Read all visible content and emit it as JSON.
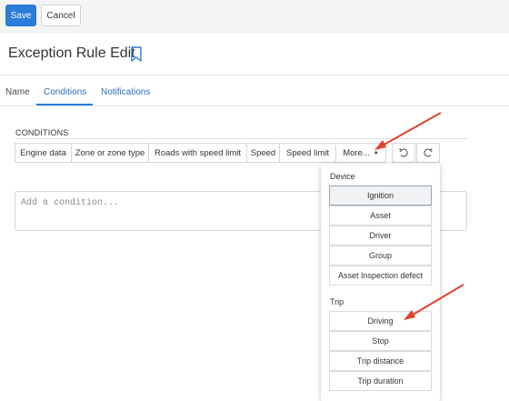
{
  "toolbar": {
    "save_label": "Save",
    "cancel_label": "Cancel"
  },
  "page": {
    "title": "Exception Rule Edit"
  },
  "tabs": [
    {
      "label": "Name"
    },
    {
      "label": "Conditions"
    },
    {
      "label": "Notifications"
    }
  ],
  "conditions": {
    "heading": "CONDITIONS",
    "buttons": [
      {
        "label": "Engine data"
      },
      {
        "label": "Zone or zone type"
      },
      {
        "label": "Roads with speed limit"
      },
      {
        "label": "Speed"
      },
      {
        "label": "Speed limit"
      },
      {
        "label": "More..."
      }
    ],
    "input_placeholder": "Add a condition..."
  },
  "dropdown": {
    "groups": [
      {
        "label": "Device",
        "items": [
          "Ignition",
          "Asset",
          "Driver",
          "Group",
          "Asset Inspection defect"
        ]
      },
      {
        "label": "Trip",
        "items": [
          "Driving",
          "Stop",
          "Trip distance",
          "Trip duration"
        ]
      }
    ],
    "selected": "Ignition"
  },
  "colors": {
    "accent": "#2a7cd8",
    "annotation_arrow": "#e0442b"
  },
  "icons": [
    "bookmark-icon",
    "caret-up-icon",
    "undo-icon",
    "redo-icon"
  ]
}
